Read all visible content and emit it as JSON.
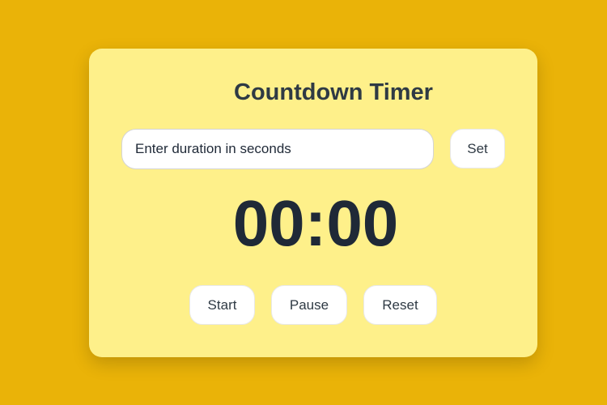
{
  "timer": {
    "title": "Countdown Timer",
    "input_placeholder": "Enter duration in seconds",
    "input_value": "",
    "set_label": "Set",
    "display": "00:00",
    "start_label": "Start",
    "pause_label": "Pause",
    "reset_label": "Reset"
  },
  "colors": {
    "page_background": "#EAB308",
    "card_background": "#FEF08A",
    "text": "#1F2937",
    "button_background": "#FFFFFF"
  }
}
